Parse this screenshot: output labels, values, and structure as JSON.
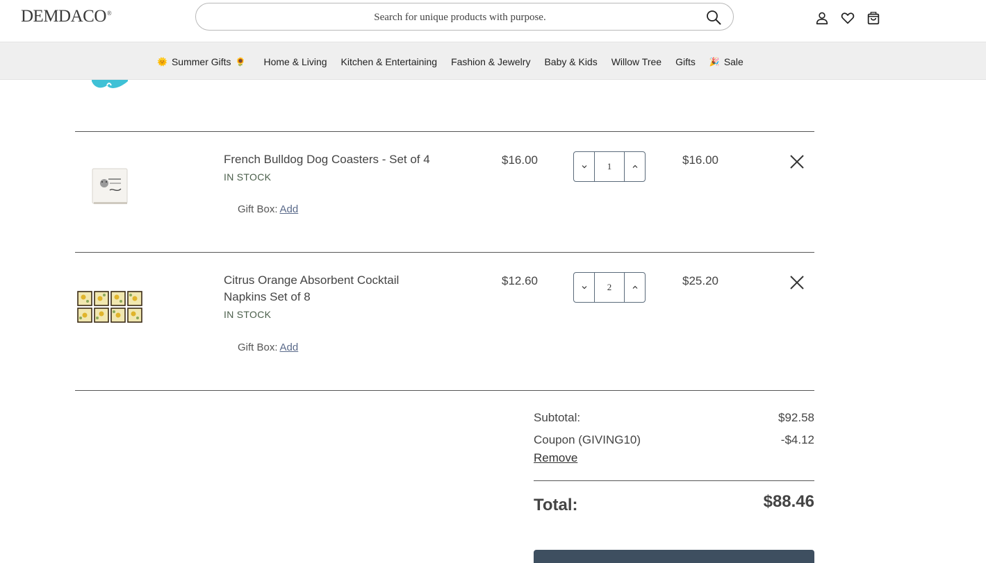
{
  "header": {
    "logo": "DEMDACO",
    "logo_mark": "®",
    "search_placeholder": "Search for unique products with purpose."
  },
  "nav": {
    "items": [
      {
        "label": "Summer Gifts",
        "lead_emoji": "🌞",
        "trail_emoji": "🌻"
      },
      {
        "label": "Home & Living"
      },
      {
        "label": "Kitchen & Entertaining"
      },
      {
        "label": "Fashion & Jewelry"
      },
      {
        "label": "Baby & Kids"
      },
      {
        "label": "Willow Tree"
      },
      {
        "label": "Gifts"
      },
      {
        "label": "Sale",
        "lead_emoji": "🎉"
      }
    ]
  },
  "cart": {
    "items": [
      {
        "title": "French Bulldog Dog Coasters - Set of 4",
        "stock": "IN STOCK",
        "gift_label": "Gift Box:",
        "gift_action": "Add",
        "price": "$16.00",
        "quantity": "1",
        "line_total": "$16.00"
      },
      {
        "title": "Citrus Orange Absorbent Cocktail Napkins Set of 8",
        "stock": "IN STOCK",
        "gift_label": "Gift Box:",
        "gift_action": "Add",
        "price": "$12.60",
        "quantity": "2",
        "line_total": "$25.20"
      }
    ]
  },
  "summary": {
    "subtotal_label": "Subtotal:",
    "subtotal_value": "$92.58",
    "coupon_label": "Coupon (GIVING10)",
    "coupon_value": "-$4.12",
    "remove_label": "Remove",
    "total_label": "Total:",
    "total_value": "$88.46"
  },
  "colors": {
    "nav_bg": "#efefef",
    "checkout_button": "#3e4f60",
    "link": "#5a6a8a",
    "stock": "#4a5e4a"
  }
}
